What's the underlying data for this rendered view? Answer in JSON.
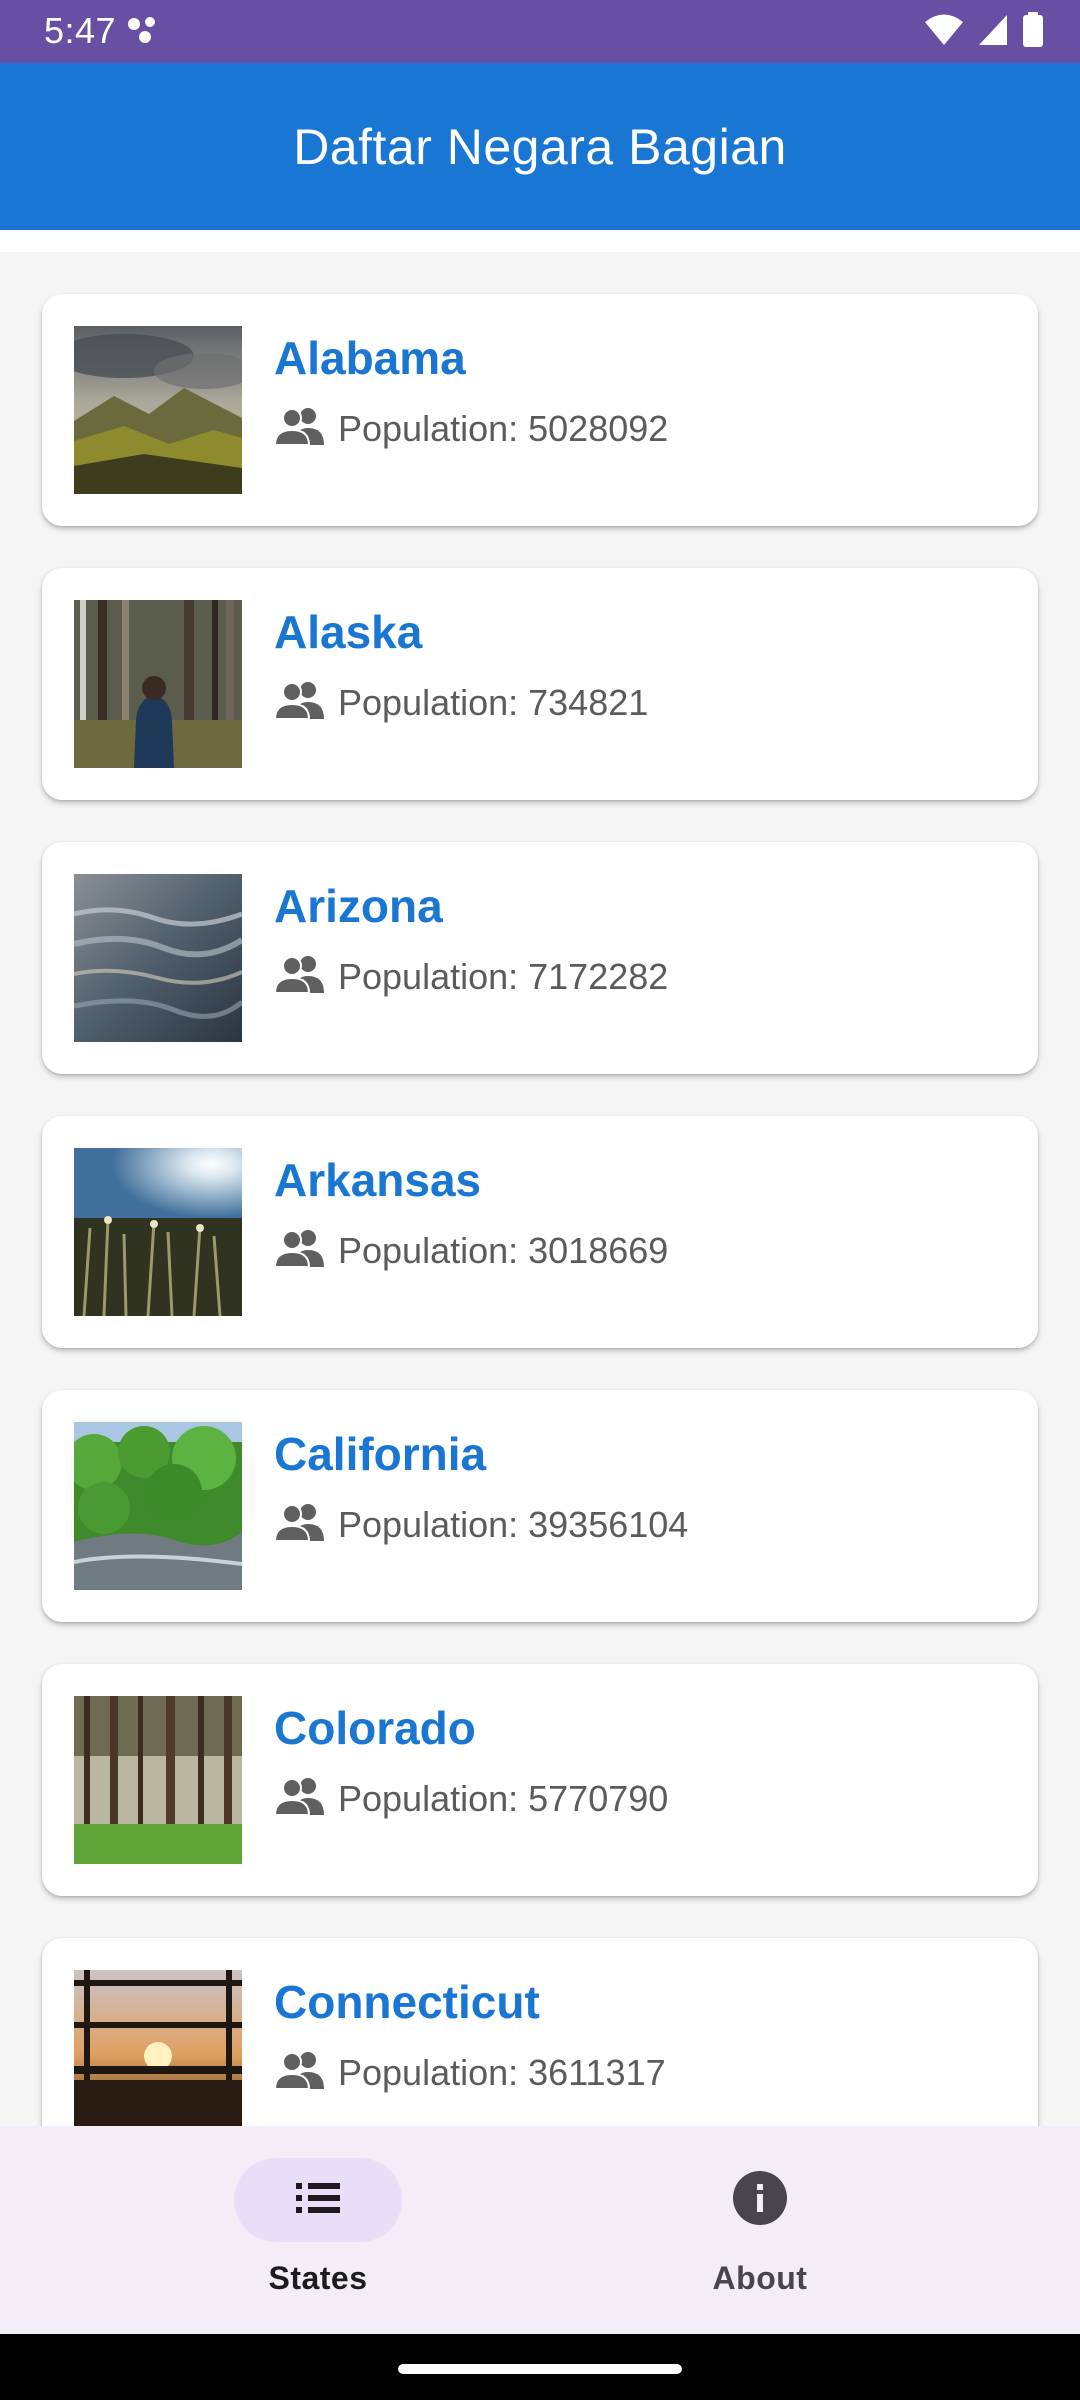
{
  "status_bar": {
    "time": "5:47",
    "icons": [
      "notification-dots-icon",
      "wifi-icon",
      "cell-signal-icon",
      "battery-icon"
    ]
  },
  "app_bar": {
    "title": "Daftar Negara Bagian"
  },
  "states": [
    {
      "name": "Alabama",
      "population": "Population: 5028092",
      "image": "mountain-valley-photo"
    },
    {
      "name": "Alaska",
      "population": "Population: 734821",
      "image": "forest-person-photo"
    },
    {
      "name": "Arizona",
      "population": "Population: 7172282",
      "image": "water-surface-photo"
    },
    {
      "name": "Arkansas",
      "population": "Population: 3018669",
      "image": "sunlit-grass-photo"
    },
    {
      "name": "California",
      "population": "Population: 39356104",
      "image": "green-river-photo"
    },
    {
      "name": "Colorado",
      "population": "Population: 5770790",
      "image": "pine-forest-photo"
    },
    {
      "name": "Connecticut",
      "population": "Population: 3611317",
      "image": "sunset-window-photo"
    }
  ],
  "bottom_nav": {
    "items": [
      {
        "label": "States",
        "icon": "list-icon",
        "active": true
      },
      {
        "label": "About",
        "icon": "info-icon",
        "active": false
      }
    ]
  },
  "colors": {
    "status_bar": "#6750a4",
    "app_bar": "#1976d2",
    "state_name": "#1976d2",
    "nav_background": "#f3edf7",
    "nav_active_pill": "#e8def8"
  }
}
